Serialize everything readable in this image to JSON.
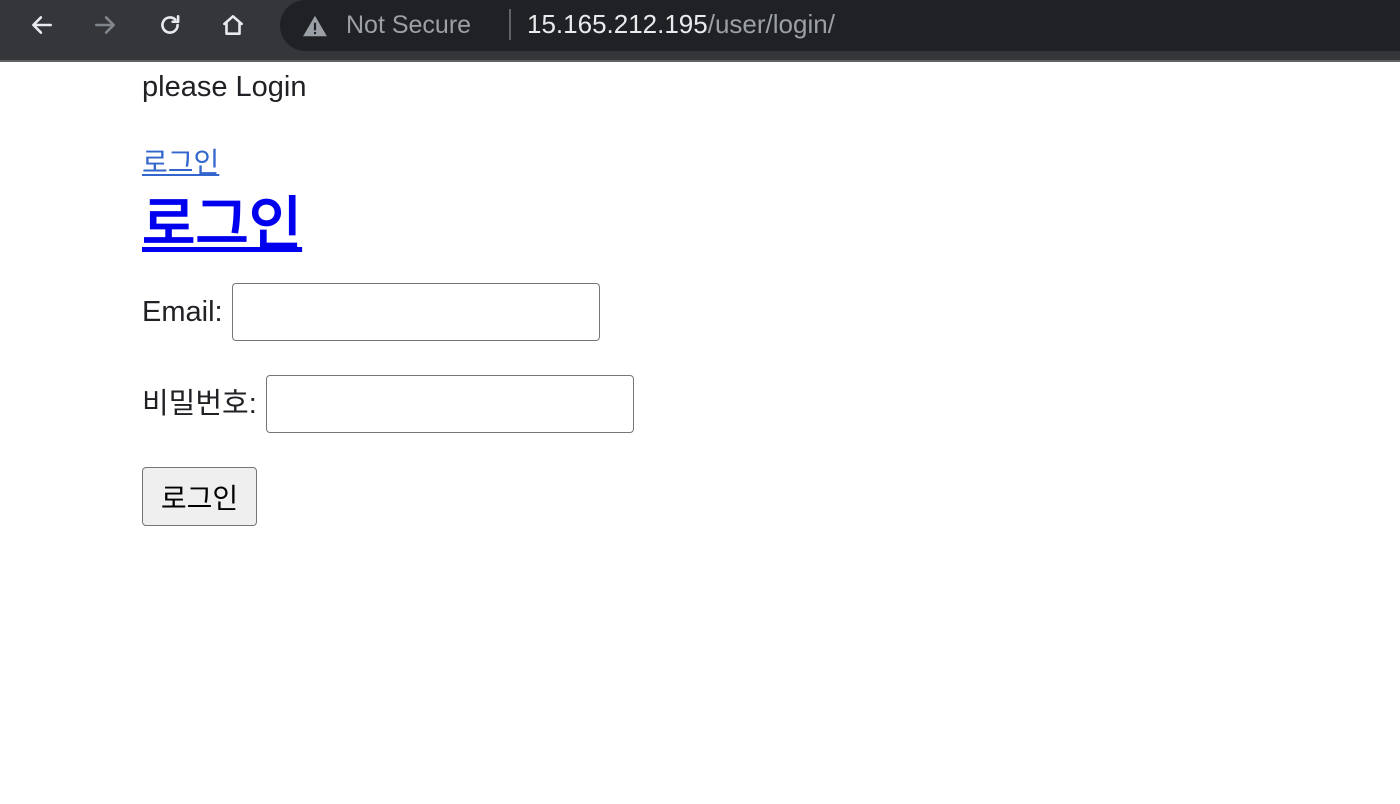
{
  "browser": {
    "security_label": "Not Secure",
    "url_host": "15.165.212.195",
    "url_path": "/user/login/",
    "icons": {
      "back": "back-arrow-icon",
      "forward": "forward-arrow-icon",
      "reload": "reload-icon",
      "home": "home-icon",
      "warning": "warning-triangle-icon"
    }
  },
  "page": {
    "greeting": "please Login",
    "nav_link": "로그인",
    "heading": "로그인",
    "form": {
      "email_label": "Email:",
      "email_value": "",
      "password_label": "비밀번호:",
      "password_value": "",
      "submit_label": "로그인"
    }
  },
  "colors": {
    "toolbar_bg": "#35363a",
    "omnibox_bg": "#202124",
    "link": "#3366cc",
    "heading_link": "#0000ee"
  }
}
